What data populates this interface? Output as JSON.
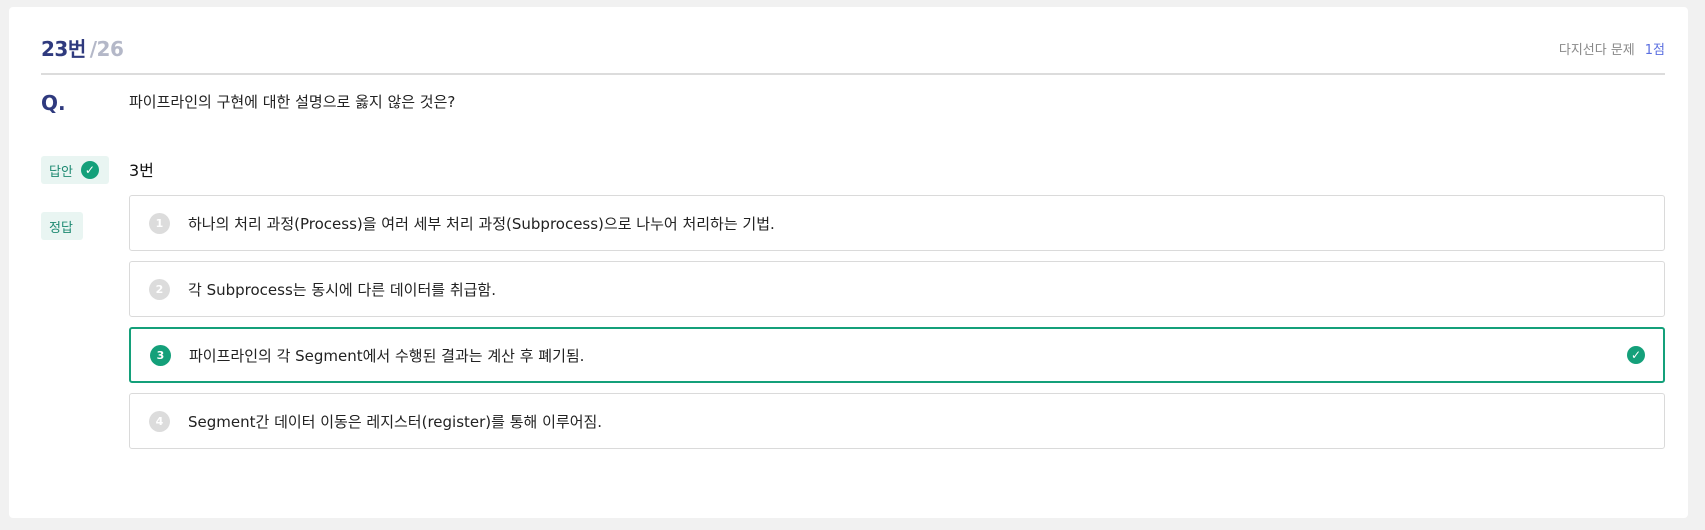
{
  "header": {
    "number": "23번",
    "total": "/26",
    "type": "다지선다 문제",
    "points": "1점"
  },
  "question": {
    "label": "Q.",
    "text": "파이프라인의 구현에 대한 설명으로 옳지 않은 것은?"
  },
  "answer": {
    "badge": "답안",
    "value": "3번"
  },
  "correct": {
    "badge": "정답"
  },
  "options": [
    {
      "num": "1",
      "text": "하나의 처리 과정(Process)을 여러 세부 처리 과정(Subprocess)으로 나누어 처리하는 기법."
    },
    {
      "num": "2",
      "text": "각 Subprocess는 동시에 다른 데이터를 취급함."
    },
    {
      "num": "3",
      "text": "파이프라인의 각 Segment에서 수행된 결과는 계산 후 폐기됨."
    },
    {
      "num": "4",
      "text": "Segment간 데이터 이동은 레지스터(register)를 통해 이루어짐."
    }
  ],
  "icons": {
    "check": "✓"
  },
  "colors": {
    "accent": "#14a07a",
    "title": "#2f3a7e",
    "points": "#5b6fe0"
  }
}
